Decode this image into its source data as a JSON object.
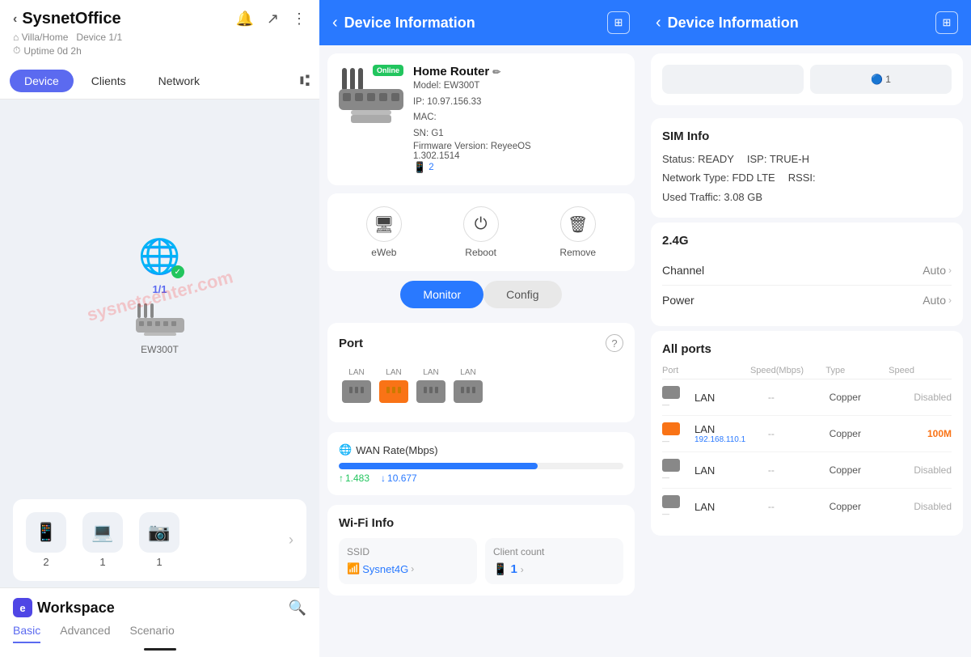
{
  "left": {
    "app_title": "SysnetOffice",
    "breadcrumb_home": "Villa/Home",
    "breadcrumb_device": "Device 1/1",
    "uptime": "Uptime 0d 2h",
    "tabs": [
      "Device",
      "Clients",
      "Network"
    ],
    "active_tab": "Device",
    "ratio_badge": "1/1",
    "device_name": "EW300T",
    "device_counts": [
      "2",
      "1",
      "1"
    ],
    "workspace_title": "Workspace",
    "bottom_tabs": [
      "Basic",
      "Advanced",
      "Scenario"
    ],
    "active_bottom_tab": "Basic"
  },
  "middle": {
    "header_title": "Device Information",
    "device_name": "Home Router",
    "model": "EW300T",
    "ip": "10.97.156.33",
    "mac": "MAC:",
    "sn": "SN: G1",
    "firmware_label": "Firmware Version: ReyeeOS",
    "firmware_version": "1.302.1514",
    "upgrade_count": "2",
    "status_badge": "Online",
    "actions": [
      "eWeb",
      "Reboot",
      "Remove"
    ],
    "monitor_label": "Monitor",
    "config_label": "Config",
    "port_section_title": "Port",
    "ports": [
      {
        "label": "LAN",
        "color": "gray"
      },
      {
        "label": "LAN",
        "color": "orange"
      },
      {
        "label": "LAN",
        "color": "gray"
      },
      {
        "label": "LAN",
        "color": "gray"
      }
    ],
    "wan_rate_title": "WAN Rate(Mbps)",
    "wan_up": "1.483",
    "wan_down": "10.677",
    "wifi_info_title": "Wi-Fi Info",
    "ssid_label": "SSID",
    "ssid_value": "Sysnet4G",
    "client_count_label": "Client count",
    "client_count_value": "1"
  },
  "right": {
    "header_title": "Device Information",
    "sim_title": "SIM Info",
    "sim_status_label": "Status:",
    "sim_status_value": "READY",
    "sim_isp_label": "ISP:",
    "sim_isp_value": "TRUE-H",
    "sim_network_label": "Network Type:",
    "sim_network_value": "FDD LTE",
    "sim_rssi_label": "RSSI:",
    "sim_rssi_value": "",
    "sim_traffic_label": "Used Traffic:",
    "sim_traffic_value": "3.08 GB",
    "g24_title": "2.4G",
    "channel_label": "Channel",
    "channel_value": "Auto",
    "power_label": "Power",
    "power_value": "Auto",
    "all_ports_title": "All ports",
    "ports_table_headers": [
      "Port",
      "Speed(Mbps)",
      "Type",
      "Speed"
    ],
    "port_rows": [
      {
        "color": "gray",
        "name": "LAN",
        "sub": "",
        "speed": "--",
        "type": "Copper",
        "status": "Disabled",
        "active": false
      },
      {
        "color": "orange",
        "name": "LAN",
        "sub": "192.168.110.1",
        "speed": "--",
        "type": "Copper",
        "status": "100M",
        "active": true
      },
      {
        "color": "gray",
        "name": "LAN",
        "sub": "",
        "speed": "--",
        "type": "Copper",
        "status": "Disabled",
        "active": false
      },
      {
        "color": "gray",
        "name": "LAN",
        "sub": "",
        "speed": "--",
        "type": "Copper",
        "status": "Disabled",
        "active": false
      }
    ]
  }
}
